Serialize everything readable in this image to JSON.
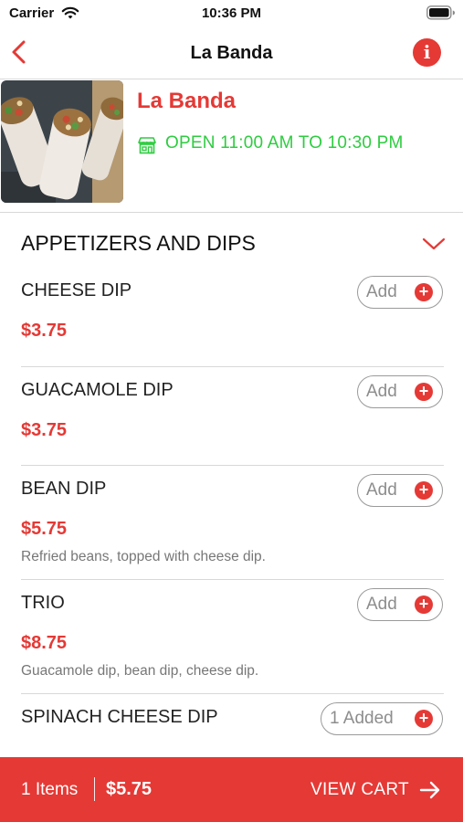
{
  "status_bar": {
    "carrier": "Carrier",
    "time": "10:36 PM"
  },
  "nav": {
    "title": "La Banda",
    "info_icon": "i"
  },
  "restaurant": {
    "name": "La Banda",
    "hours": "OPEN 11:00 AM TO 10:30 PM",
    "icons": {
      "hours": "store-icon"
    }
  },
  "section": {
    "title": "APPETIZERS AND DIPS"
  },
  "items": [
    {
      "name": "CHEESE DIP",
      "price": "$3.75",
      "description": "",
      "button": "Add"
    },
    {
      "name": "GUACAMOLE DIP",
      "price": "$3.75",
      "description": "",
      "button": "Add"
    },
    {
      "name": "BEAN DIP",
      "price": "$5.75",
      "description": "Refried beans, topped with cheese dip.",
      "button": "Add"
    },
    {
      "name": "TRIO",
      "price": "$8.75",
      "description": "Guacamole dip, bean dip, cheese dip.",
      "button": "Add"
    },
    {
      "name": "SPINACH CHEESE DIP",
      "price": "",
      "description": "",
      "button": "1 Added"
    }
  ],
  "cart": {
    "count": "1 Items",
    "total": "$5.75",
    "view_label": "VIEW CART"
  },
  "colors": {
    "accent": "#e53935",
    "open_status": "#2ecc40",
    "divider": "#d8d8d8"
  }
}
